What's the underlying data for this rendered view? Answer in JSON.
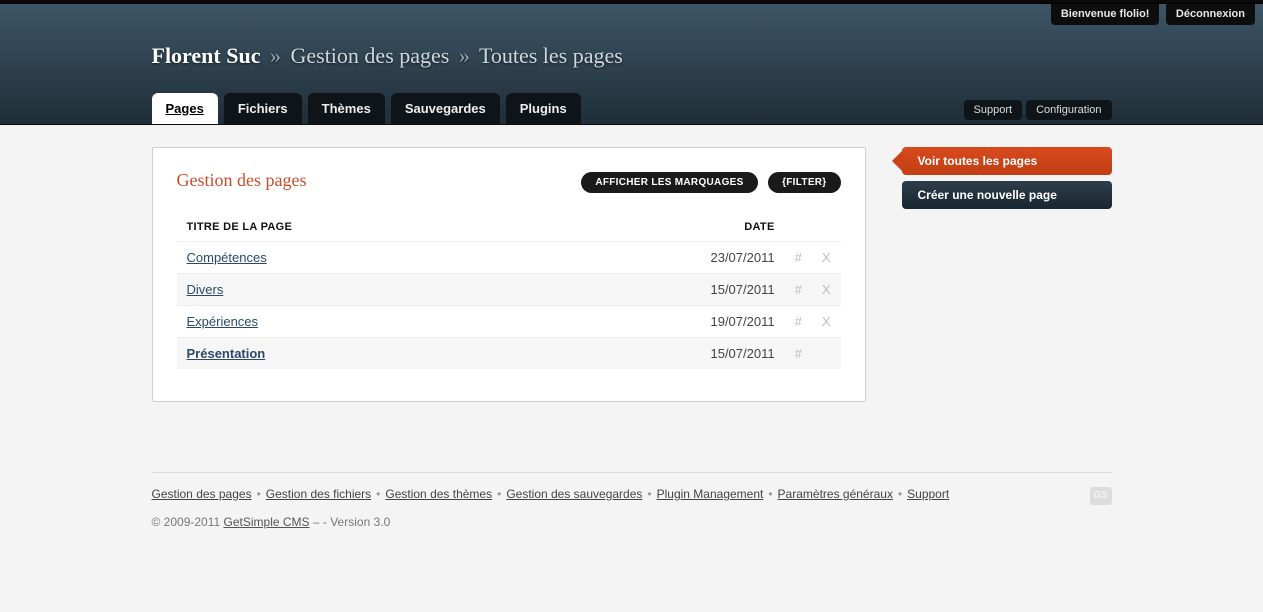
{
  "user_bar": {
    "welcome": "Bienvenue flolio!",
    "logout": "Déconnexion"
  },
  "breadcrumb": {
    "site": "Florent Suc",
    "sep": "»",
    "level1": "Gestion des pages",
    "level2": "Toutes les pages"
  },
  "tabs": [
    {
      "label": "Pages",
      "active": true
    },
    {
      "label": "Fichiers"
    },
    {
      "label": "Thèmes"
    },
    {
      "label": "Sauvegardes"
    },
    {
      "label": "Plugins"
    }
  ],
  "right_tabs": {
    "support": "Support",
    "config": "Configuration"
  },
  "panel": {
    "title": "Gestion des pages",
    "btn_tags": "AFFICHER LES MARQUAGES",
    "btn_filter": "{FILTER}"
  },
  "columns": {
    "title": "TITRE DE LA PAGE",
    "date": "DATE"
  },
  "rows": [
    {
      "title": "Compétences",
      "date": "23/07/2011",
      "hash": "#",
      "del": "X",
      "bold": false
    },
    {
      "title": "Divers",
      "date": "15/07/2011",
      "hash": "#",
      "del": "X",
      "bold": false
    },
    {
      "title": "Expériences",
      "date": "19/07/2011",
      "hash": "#",
      "del": "X",
      "bold": false
    },
    {
      "title": "Présentation",
      "date": "15/07/2011",
      "hash": "#",
      "del": "",
      "bold": true
    }
  ],
  "sidebar": {
    "view_all": "Voir toutes les pages",
    "create_new": "Créer une nouvelle page"
  },
  "footer_links": [
    "Gestion des pages",
    "Gestion des fichiers",
    "Gestion des thèmes",
    "Gestion des sauvegardes",
    "Plugin Management",
    "Paramètres généraux",
    "Support"
  ],
  "footer": {
    "copy_prefix": "© 2009-2011 ",
    "product": "GetSimple CMS",
    "copy_suffix": " – - Version 3.0",
    "badge": "GS",
    "bullet": "•"
  }
}
